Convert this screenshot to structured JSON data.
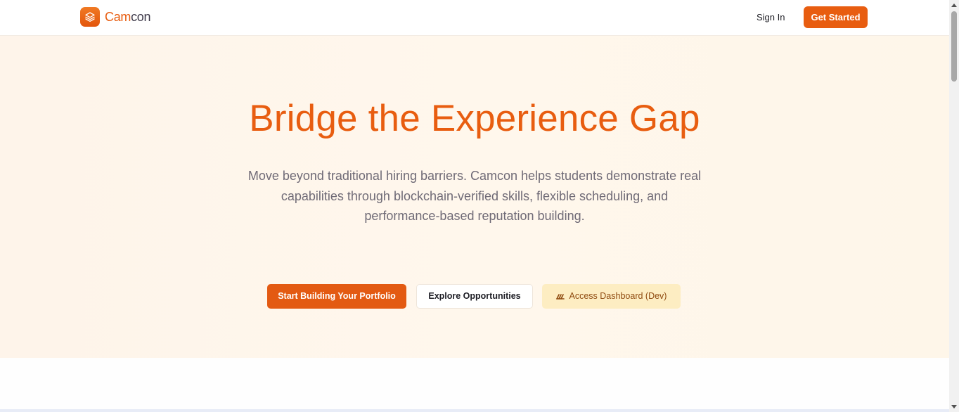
{
  "header": {
    "logo_part1": "Cam",
    "logo_part2": "con",
    "sign_in_label": "Sign In",
    "get_started_label": "Get Started"
  },
  "hero": {
    "title": "Bridge the Experience Gap",
    "subtitle": "Move beyond traditional hiring barriers. Camcon helps students demonstrate real capabilities through blockchain-verified skills, flexible scheduling, and performance-based reputation building.",
    "primary_button_label": "Start Building Your Portfolio",
    "secondary_button_label": "Explore Opportunities",
    "dev_button_label": "Access Dashboard (Dev)"
  },
  "icons": {
    "logo": "layers-icon",
    "dev_button": "chart-icon",
    "scroll_up": "scroll-up-arrow-icon",
    "scroll_down": "scroll-down-arrow-icon"
  },
  "colors": {
    "brand": "#e85d10",
    "hero_bg": "#fff7ec",
    "dev_button_bg": "#fdedc2",
    "dev_button_text": "#8f4a0f",
    "subtitle_text": "#6f6a76"
  }
}
